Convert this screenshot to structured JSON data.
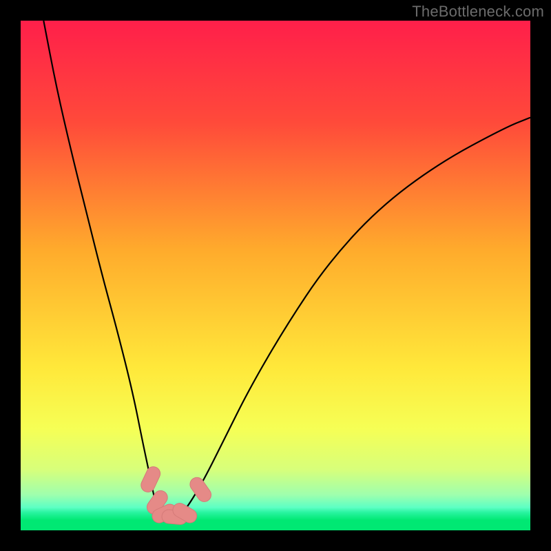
{
  "attribution": "TheBottleneck.com",
  "chart_data": {
    "type": "line",
    "title": "",
    "xlabel": "",
    "ylabel": "",
    "xlim": [
      0,
      100
    ],
    "ylim": [
      0,
      100
    ],
    "grid": false,
    "legend": false,
    "background_gradient": {
      "stops": [
        {
          "offset": 0,
          "color": "#ff1f4a"
        },
        {
          "offset": 0.2,
          "color": "#ff4a3a"
        },
        {
          "offset": 0.45,
          "color": "#ffab2c"
        },
        {
          "offset": 0.68,
          "color": "#ffe83a"
        },
        {
          "offset": 0.8,
          "color": "#f6ff55"
        },
        {
          "offset": 0.88,
          "color": "#d8ff7a"
        },
        {
          "offset": 0.93,
          "color": "#9fffad"
        },
        {
          "offset": 0.955,
          "color": "#5dffc4"
        },
        {
          "offset": 0.965,
          "color": "#28f4a0"
        },
        {
          "offset": 0.98,
          "color": "#00e873"
        },
        {
          "offset": 1.0,
          "color": "#00e873"
        }
      ]
    },
    "series": [
      {
        "name": "bottleneck-curve",
        "color": "#000000",
        "x": [
          4.5,
          7,
          10,
          13,
          16,
          19,
          22,
          24,
          25.5,
          26.5,
          27.5,
          29,
          31,
          33,
          36,
          40,
          45,
          52,
          60,
          70,
          82,
          95,
          100
        ],
        "y": [
          100,
          87,
          74,
          62,
          50,
          39,
          27,
          17,
          10,
          5,
          2.5,
          2.5,
          2.5,
          5,
          10,
          18,
          28,
          40,
          52,
          63,
          72,
          79,
          81
        ]
      }
    ],
    "markers": {
      "name": "highlight-markers",
      "shape": "capsule",
      "fill": "#e58a87",
      "stroke": "#d47a78",
      "points": [
        {
          "cx": 25.5,
          "cy": 10,
          "angle": -65,
          "len": 5.2
        },
        {
          "cx": 26.8,
          "cy": 5.5,
          "angle": -55,
          "len": 5.0
        },
        {
          "cx": 28.2,
          "cy": 3.3,
          "angle": -25,
          "len": 5.0
        },
        {
          "cx": 30.2,
          "cy": 2.6,
          "angle": 5,
          "len": 5.0
        },
        {
          "cx": 32.2,
          "cy": 3.4,
          "angle": 30,
          "len": 5.0
        },
        {
          "cx": 35.3,
          "cy": 8.0,
          "angle": 55,
          "len": 5.2
        }
      ]
    }
  }
}
